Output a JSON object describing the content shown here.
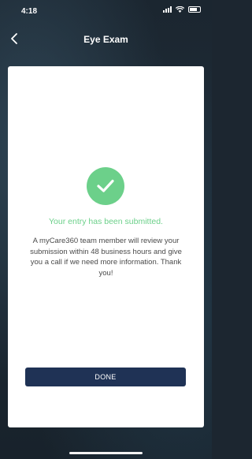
{
  "status_bar": {
    "time": "4:18"
  },
  "header": {
    "title": "Eye Exam",
    "back_icon": "chevron-left-icon"
  },
  "confirmation": {
    "icon": "check-circle-icon",
    "success_text": "Your entry has been submitted.",
    "message": "A myCare360 team member will review your submission within 48 business hours and give you a call if we need more information. Thank you!"
  },
  "actions": {
    "done_label": "DONE"
  },
  "colors": {
    "success_green": "#6cd08a",
    "button_navy": "#1f3255",
    "background": "#1c2630"
  }
}
